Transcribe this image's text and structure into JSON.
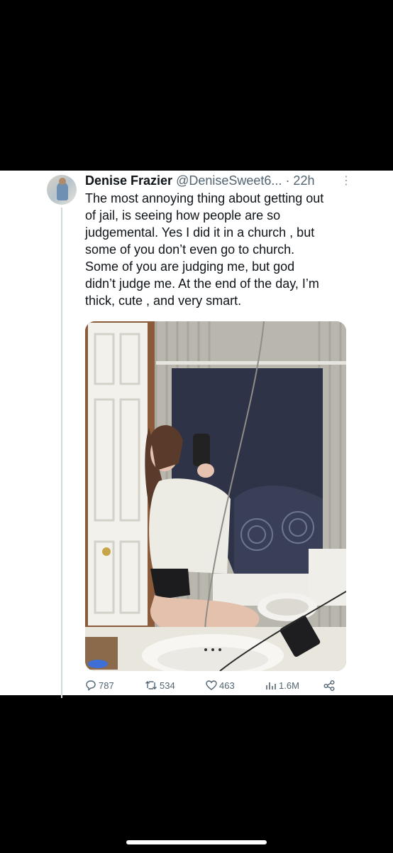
{
  "tweet": {
    "author_name": "Denise Frazier",
    "handle": "@DeniseSweet6...",
    "time": "· 22h",
    "more": "⋮",
    "text_lines": [
      "The most annoying thing about getting out",
      "of jail, is seeing how people are so",
      "judgemental. Yes I did it in a church , but",
      "some of you don’t even go to church.",
      "Some of you are judging me, but god",
      "didn’t judge me.  At the end of the day, I’m",
      "thick, cute , and very smart."
    ]
  },
  "actions": {
    "replies": "787",
    "retweets": "534",
    "likes": "463",
    "views": "1.6M"
  },
  "icons": [
    "reply-icon",
    "retweet-icon",
    "like-icon",
    "views-icon",
    "share-icon",
    "more-icon"
  ],
  "colors": {
    "background": "#000000",
    "card": "#ffffff",
    "text": "#0f1419",
    "secondary": "#536471"
  }
}
